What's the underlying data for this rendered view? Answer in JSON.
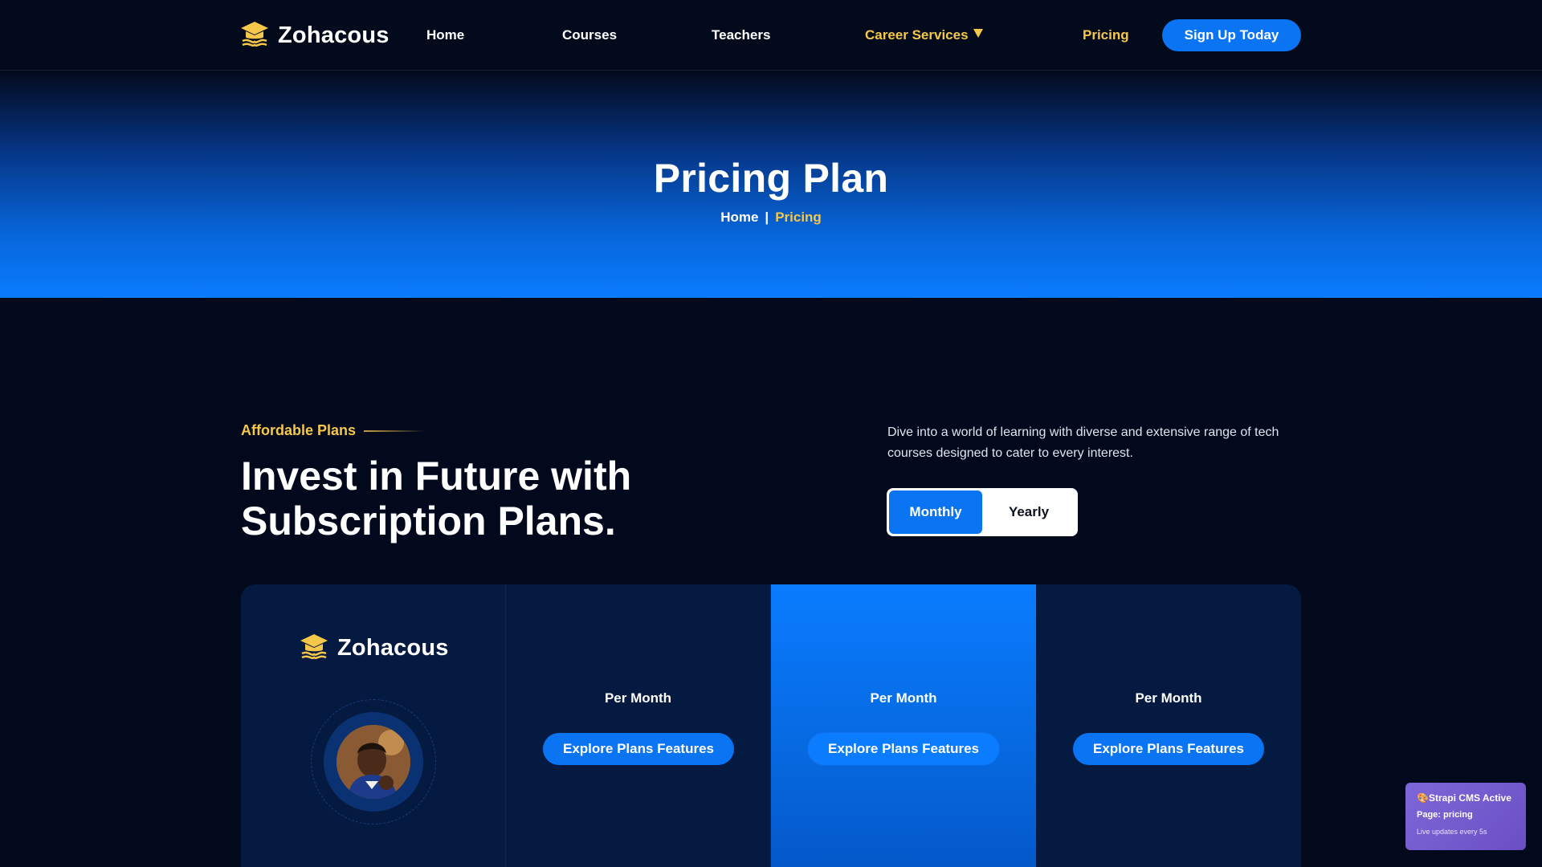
{
  "header": {
    "brand": "Zohacous",
    "nav": {
      "home": "Home",
      "courses": "Courses",
      "teachers": "Teachers",
      "career_services": "Career Services",
      "pricing": "Pricing"
    },
    "signup_label": "Sign Up Today"
  },
  "hero": {
    "title": "Pricing Plan",
    "breadcrumb": {
      "home": "Home",
      "separator": "|",
      "current": "Pricing"
    }
  },
  "intro": {
    "eyebrow": "Affordable Plans",
    "heading_line1": "Invest in Future with",
    "heading_line2": "Subscription Plans.",
    "description": "Dive into a world of learning with diverse and extensive range of tech courses designed to cater to every interest.",
    "toggle": {
      "monthly": "Monthly",
      "yearly": "Yearly",
      "selected": "Monthly"
    }
  },
  "pricing": {
    "brand": "Zohacous",
    "plans": [
      {
        "period": "Per Month",
        "cta": "Explore Plans Features"
      },
      {
        "period": "Per Month",
        "cta": "Explore Plans Features"
      },
      {
        "period": "Per Month",
        "cta": "Explore Plans Features"
      }
    ]
  },
  "cms_widget": {
    "title": "Strapi CMS Active",
    "page": "Page: pricing",
    "live": "Live updates every 5s"
  },
  "colors": {
    "accent_blue": "#0a74f2",
    "accent_gold": "#f6c84a",
    "background": "#03091c"
  }
}
